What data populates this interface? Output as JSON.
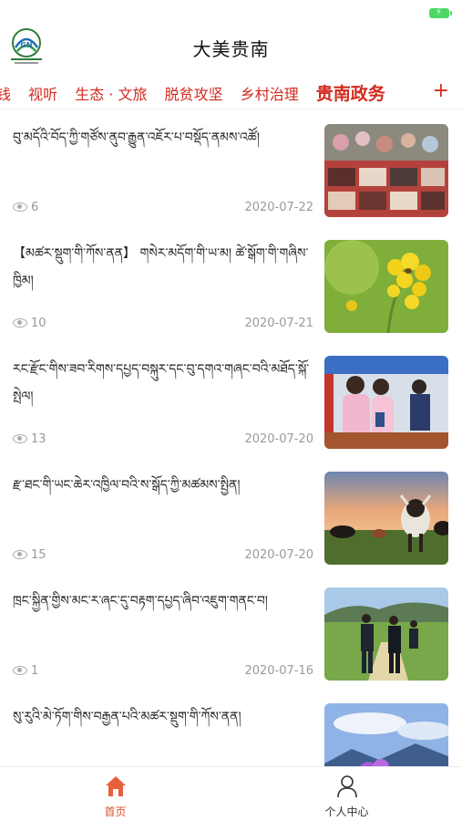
{
  "app": {
    "title": "大美贵南"
  },
  "channels": [
    {
      "label": "钱",
      "active": false
    },
    {
      "label": "视听",
      "active": false
    },
    {
      "label": "生态 · 文旅",
      "active": false
    },
    {
      "label": "脱贫攻坚",
      "active": false
    },
    {
      "label": "乡村治理",
      "active": false
    },
    {
      "label": "贵南政务",
      "active": true
    }
  ],
  "add_channel_icon": "plus-icon",
  "news": [
    {
      "title": "བུ་མདོའི་བོད་ཀྱི་གཙོས་ནུབ་རྒྱུན་འཇོར་པ་བསྡོད་ནམས་འཚོ།",
      "views": "6",
      "date": "2020-07-22",
      "image": "market-stalls-photo"
    },
    {
      "title": "【མཚར་སྡུག་གི་ཀོས་ནན】 གསེར་མདོག་གི་ཡ་མ། ཚེ་སྒོག་གི་གཞིས་ཁྱིམ།",
      "views": "10",
      "date": "2020-07-21",
      "image": "rapeseed-bee-photo"
    },
    {
      "title": "རང་རྫོང་གིས་ཟབ་རིགས་དཔྱད་བསྐུར་དང་བུ་དགའ་གཞང་བའི་མཐོད་སྐོ་སྤེལ།",
      "views": "13",
      "date": "2020-07-20",
      "image": "exhibition-booth-photo"
    },
    {
      "title": "རྫ་ཐང་གི་ཡང་ཆེར་འཁྱིལ་བའི་ས་སྒོད་ཀྱི་མཚམས་སྤྱིན།",
      "views": "15",
      "date": "2020-07-20",
      "image": "yak-grassland-photo"
    },
    {
      "title": "ཁྲང་སྐྱིན་གྱིས་མང་ར་ཞང་དུ་བརྟག་དཔྱད་ཞིབ་འཇུག་གནང་བ།",
      "views": "1",
      "date": "2020-07-16",
      "image": "officials-walking-photo"
    },
    {
      "title": "སུ་རུའི་མེ་ཏོག་གིས་བརྒྱན་པའི་མཚར་སྡུག་གི་ཀོས་ནན།",
      "views": "",
      "date": "",
      "image": "flowers-mountain-photo"
    }
  ],
  "tabs": [
    {
      "label": "首页",
      "icon": "home-icon",
      "active": true
    },
    {
      "label": "个人中心",
      "icon": "user-icon",
      "active": false
    }
  ],
  "colors": {
    "accent": "#d22a1e",
    "tab_active": "#d9532a",
    "meta": "#9a9a9a"
  }
}
